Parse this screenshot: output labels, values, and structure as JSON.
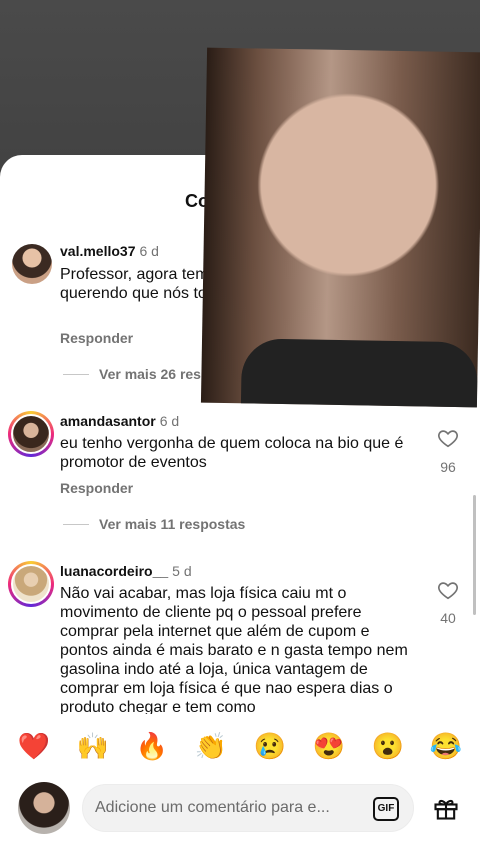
{
  "sheet": {
    "title": "Comentários"
  },
  "comments": [
    {
      "username": "val.mello37",
      "time": "6 d",
      "text": "Professor, agora tem muitas pessoas não querendo que nós tornamos inúteis. 😢",
      "reply_label": "Responder",
      "more_replies": "Ver mais 26 respostas",
      "likes": ""
    },
    {
      "username": "amandasantor",
      "time": "6 d",
      "text": "eu tenho vergonha de quem coloca na bio que é promotor de eventos",
      "reply_label": "Responder",
      "more_replies": "Ver mais 11 respostas",
      "likes": "96"
    },
    {
      "username": "luanacordeiro__",
      "time": "5 d",
      "text": "Não vai acabar,  mas loja física caiu mt o movimento de cliente pq o pessoal prefere comprar pela internet que além de cupom e pontos ainda é mais barato e n gasta tempo nem gasolina indo até a loja, única vantagem de comprar em loja física é que nao espera dias o produto chegar e tem como",
      "likes": "40"
    }
  ],
  "quick_reactions": [
    "❤️",
    "🙌",
    "🔥",
    "👏",
    "😢",
    "😍",
    "😮",
    "😂"
  ],
  "composer": {
    "placeholder": "Adicione um comentário para e...",
    "gif_label": "GIF"
  },
  "icons": {
    "like": "heart-icon",
    "gift": "gift-icon",
    "gif": "gif-icon"
  },
  "colors": {
    "muted": "#737373",
    "sheet": "#ffffff",
    "ring_start": "#f9ce34",
    "ring_end": "#6228d7"
  }
}
